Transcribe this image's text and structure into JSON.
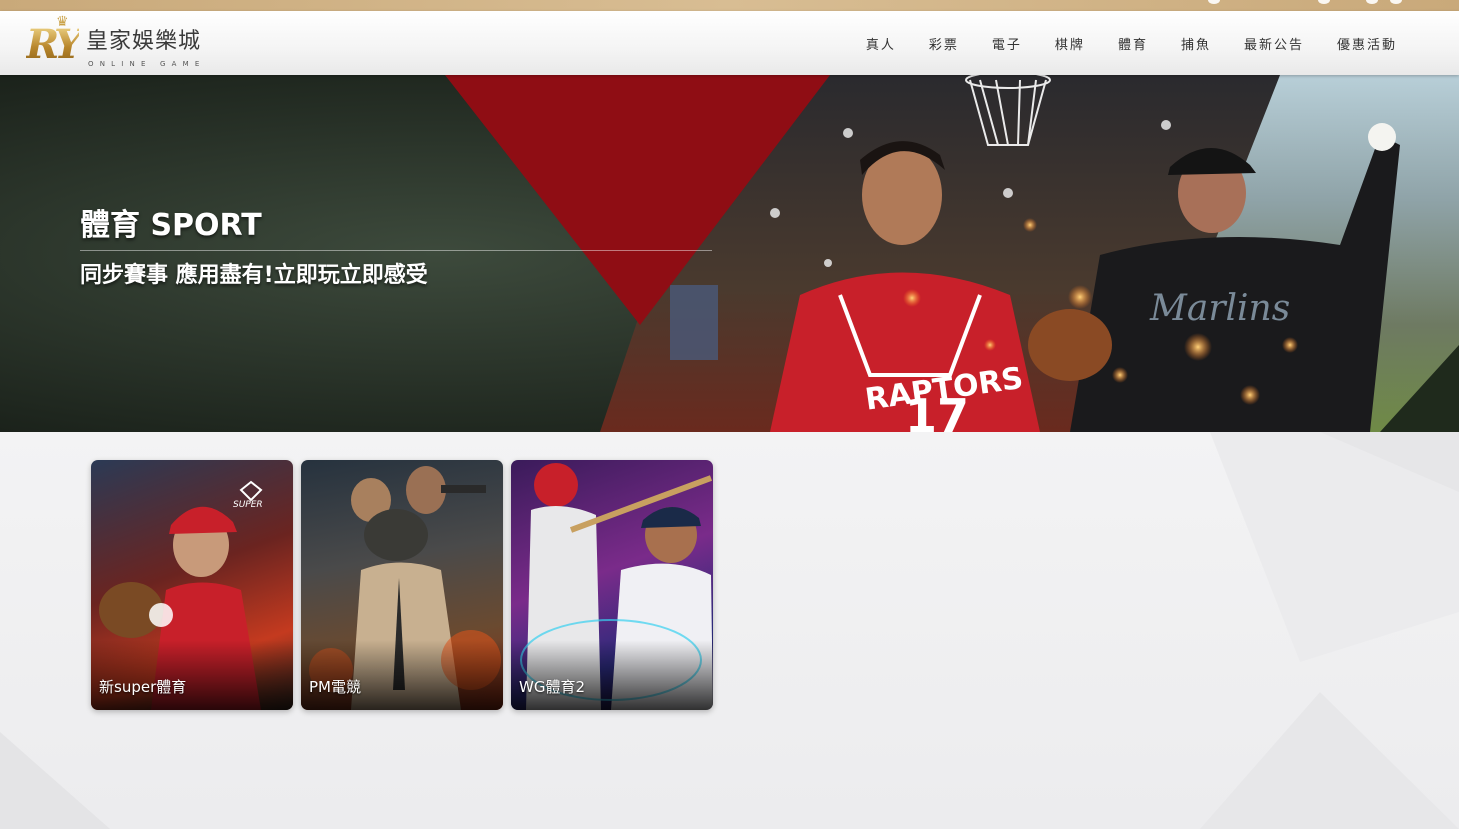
{
  "header": {
    "logo": {
      "initials": "RY",
      "name": "皇家娛樂城",
      "tagline": "ONLINE GAME"
    },
    "nav": [
      {
        "label": "真人"
      },
      {
        "label": "彩票"
      },
      {
        "label": "電子"
      },
      {
        "label": "棋牌"
      },
      {
        "label": "體育"
      },
      {
        "label": "捕魚"
      },
      {
        "label": "最新公告"
      },
      {
        "label": "優惠活動"
      }
    ]
  },
  "banner": {
    "title": "體育 SPORT",
    "subtitle": "同步賽事 應用盡有!立即玩立即感受",
    "jersey_text": "RAPTORS",
    "jersey_number": "17",
    "jersey2_text": "Marlins",
    "accent_color": "#8f0d14"
  },
  "games": [
    {
      "label": "新super體育",
      "badge": "SUPER"
    },
    {
      "label": "PM電競"
    },
    {
      "label": "WG體育2"
    }
  ]
}
